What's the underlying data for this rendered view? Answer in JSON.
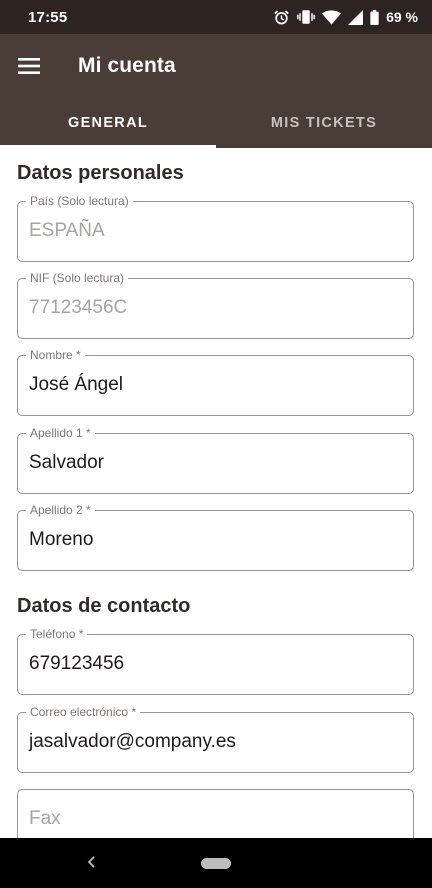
{
  "status_bar": {
    "time": "17:55",
    "battery": "69 %",
    "icons": [
      "alarm-icon",
      "vibrate-icon",
      "wifi-icon",
      "signal-icon",
      "battery-icon"
    ]
  },
  "app_bar": {
    "title": "Mi cuenta",
    "menu_icon": "hamburger-menu-icon"
  },
  "tabs": [
    {
      "label": "GENERAL",
      "active": true
    },
    {
      "label": "MIS TICKETS",
      "active": false
    }
  ],
  "sections": {
    "personal": {
      "title": "Datos personales",
      "fields": [
        {
          "label": "País (Solo lectura)",
          "value": "ESPAÑA",
          "readonly": true
        },
        {
          "label": "NIF (Solo lectura)",
          "value": "77123456C",
          "readonly": true
        },
        {
          "label": "Nombre *",
          "value": "José Ángel"
        },
        {
          "label": "Apellido 1 *",
          "value": "Salvador"
        },
        {
          "label": "Apellido 2 *",
          "value": "Moreno"
        }
      ]
    },
    "contact": {
      "title": "Datos de contacto",
      "fields": [
        {
          "label": "Teléfono *",
          "value": "679123456"
        },
        {
          "label": "Correo electrónico *",
          "value": "jasalvador@company.es"
        },
        {
          "label": "",
          "placeholder": "Fax"
        }
      ]
    }
  },
  "colors": {
    "app_bar": "#4a3d38",
    "status_bar": "#2e2522",
    "section_title": "#332a27",
    "field_border": "#9a9492"
  }
}
